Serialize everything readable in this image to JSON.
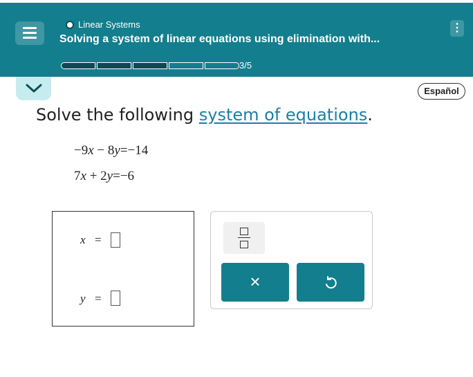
{
  "header": {
    "topic": "Linear Systems",
    "lesson_title": "Solving a system of linear equations using elimination with...",
    "progress_text": "3/5",
    "progress": {
      "filled": 3,
      "total": 5
    },
    "accent_color": "#137e8e"
  },
  "language_button": "Español",
  "question": {
    "prompt_prefix": "Solve the following ",
    "prompt_link": "system of equations",
    "prompt_suffix": ".",
    "eq1": {
      "a": "−9",
      "v1": "x",
      "op": "−",
      "b": "8",
      "v2": "y",
      "eq": "=",
      "rhs": "−14"
    },
    "eq2": {
      "a": "7",
      "v1": "x",
      "op": "+",
      "b": "2",
      "v2": "y",
      "eq": "=",
      "rhs": "−6"
    }
  },
  "answer": {
    "x_label": "x",
    "y_label": "y",
    "equals": "=",
    "x_value": "",
    "y_value": ""
  },
  "keypad": {
    "clear_symbol": "×"
  },
  "icons": [
    "menu-icon",
    "more-vertical-icon",
    "chevron-down-icon",
    "fraction-icon",
    "close-icon",
    "undo-icon"
  ]
}
